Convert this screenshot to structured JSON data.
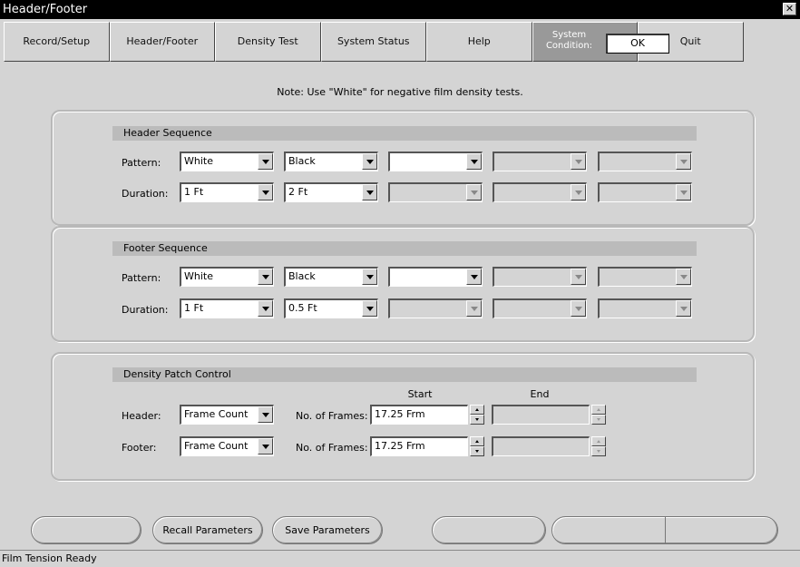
{
  "window": {
    "title": "Header/Footer",
    "close_glyph": "✕"
  },
  "nav": {
    "tabs": [
      "Record/Setup",
      "Header/Footer",
      "Density Test",
      "System Status",
      "Help"
    ],
    "system_condition_label": "System Condition:",
    "system_condition_value": "OK",
    "quit_label": "Quit"
  },
  "note": "Note: Use \"White\" for negative film density tests.",
  "header_sequence": {
    "title": "Header Sequence",
    "pattern_label": "Pattern:",
    "duration_label": "Duration:",
    "pattern": [
      "White",
      "Black",
      "",
      "",
      ""
    ],
    "duration": [
      "1 Ft",
      "2 Ft",
      "",
      "",
      ""
    ]
  },
  "footer_sequence": {
    "title": "Footer Sequence",
    "pattern_label": "Pattern:",
    "duration_label": "Duration:",
    "pattern": [
      "White",
      "Black",
      "",
      "",
      ""
    ],
    "duration": [
      "1 Ft",
      "0.5 Ft",
      "",
      "",
      ""
    ]
  },
  "density_patch": {
    "title": "Density Patch Control",
    "start_label": "Start",
    "end_label": "End",
    "header": {
      "label": "Header:",
      "mode": "Frame Count",
      "frames_label": "No. of Frames:",
      "start": "17.25 Frm",
      "end": ""
    },
    "footer": {
      "label": "Footer:",
      "mode": "Frame Count",
      "frames_label": "No. of Frames:",
      "start": "17.25 Frm",
      "end": ""
    }
  },
  "bottom_buttons": {
    "recall": "Recall Parameters",
    "save": "Save Parameters"
  },
  "status": "Film Tension Ready"
}
